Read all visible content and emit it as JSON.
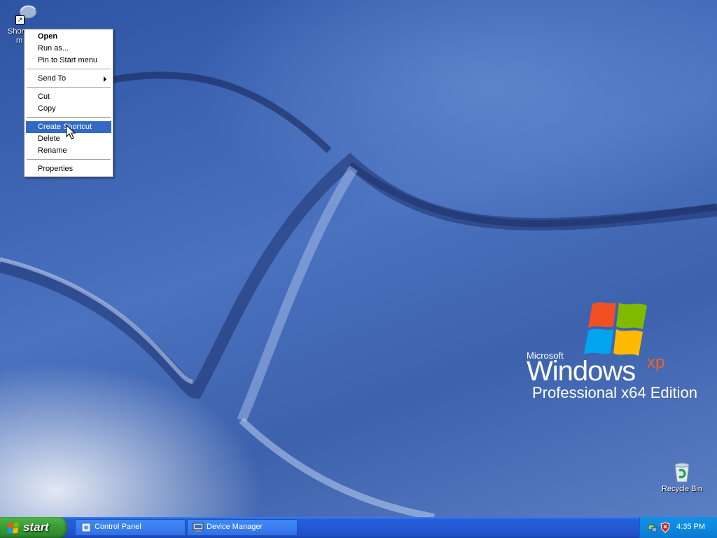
{
  "desktop": {
    "icons": [
      {
        "label": "Shortcut to m...",
        "visible_label": "Shor",
        "visible_label2": "m"
      },
      {
        "label": "Recycle Bin"
      }
    ],
    "branding": {
      "company": "Microsoft",
      "product": "Windows",
      "version": "xp",
      "edition": "Professional x64 Edition"
    }
  },
  "context_menu": {
    "items": [
      {
        "label": "Open",
        "bold": true
      },
      {
        "label": "Run as..."
      },
      {
        "label": "Pin to Start menu"
      },
      {
        "label": "Send To",
        "submenu": true
      },
      {
        "label": "Cut"
      },
      {
        "label": "Copy"
      },
      {
        "label": "Create Shortcut",
        "highlighted": true
      },
      {
        "label": "Delete"
      },
      {
        "label": "Rename"
      },
      {
        "label": "Properties"
      }
    ]
  },
  "taskbar": {
    "start_label": "start",
    "buttons": [
      {
        "label": "Control Panel",
        "icon": "control-panel-icon"
      },
      {
        "label": "Device Manager",
        "icon": "device-manager-icon"
      }
    ],
    "tray": {
      "icons": [
        "network-icon",
        "security-shield-icon"
      ],
      "clock": "4:35 PM"
    }
  },
  "colors": {
    "menu_highlight": "#316ac5",
    "taskbar_blue": "#245edb",
    "start_green": "#3c9f37",
    "tray_blue": "#0c8ae0"
  }
}
